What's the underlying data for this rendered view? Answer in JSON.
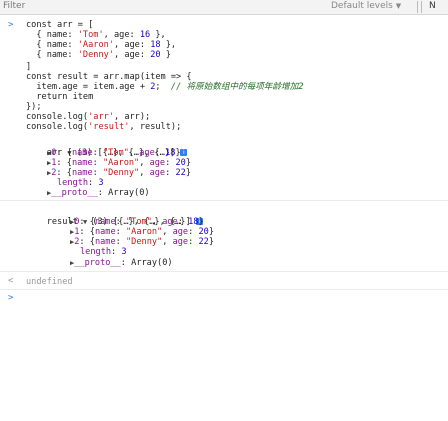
{
  "toolbar": {
    "filter_placeholder": "Filter",
    "levels_label": "Default levels",
    "levels_arrow": "▼",
    "extra_label": "N"
  },
  "console": {
    "prompt_chevron": ">",
    "result_chevron": "<",
    "code": {
      "l1": "const arr = [",
      "l2_a": "  { name: ",
      "l2_s": "'Tom'",
      "l2_b": ", age: ",
      "l2_n": "16",
      "l2_c": " },",
      "l3_a": "  { name: ",
      "l3_s": "'Aaron'",
      "l3_b": ", age: ",
      "l3_n": "18",
      "l3_c": " },",
      "l4_a": "  { name: ",
      "l4_s": "'Denny'",
      "l4_b": ", age: ",
      "l4_n": "20",
      "l4_c": " }",
      "l5": "]",
      "l6": "const result = arr.map(item => {",
      "l7_a": "  item.age = item.age + ",
      "l7_n": "2",
      "l7_b": ";  ",
      "l7_cmt": "// ",
      "l7_cj": "将原始数组中的每项年龄增加2",
      "l8": "  return item",
      "l9": "});",
      "l10_a": "console.log(",
      "l10_s": "'arr'",
      "l10_b": ", arr);",
      "l11_a": "console.log(",
      "l11_s": "'result'",
      "l11_b": ", result);"
    },
    "arr_output": {
      "label": "arr",
      "summary": " (3) [{…}, {…}, {…}]",
      "items": [
        {
          "index": "0",
          "name": "\"Tom\"",
          "age": "18"
        },
        {
          "index": "1",
          "name": "\"Aaron\"",
          "age": "20"
        },
        {
          "index": "2",
          "name": "\"Denny\"",
          "age": "22"
        }
      ],
      "length_key": "length",
      "length_val": "3",
      "proto_key": "__proto__",
      "proto_val": "Array(0)"
    },
    "result_output": {
      "label": "result",
      "summary": " (3) [{…}, {…}, {…}]",
      "items": [
        {
          "index": "0",
          "name": "\"Tom\"",
          "age": "18"
        },
        {
          "index": "1",
          "name": "\"Aaron\"",
          "age": "20"
        },
        {
          "index": "2",
          "name": "\"Denny\"",
          "age": "22"
        }
      ],
      "length_key": "length",
      "length_val": "3",
      "proto_key": "__proto__",
      "proto_val": "Array(0)"
    },
    "return_value": "undefined",
    "info_glyph": "i",
    "expanded_glyph": "▼",
    "collapsed_glyph": "▶"
  }
}
